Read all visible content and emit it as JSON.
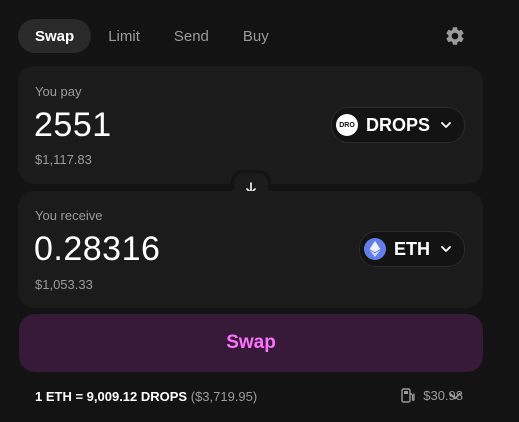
{
  "tabs": [
    {
      "label": "Swap",
      "active": true
    },
    {
      "label": "Limit",
      "active": false
    },
    {
      "label": "Send",
      "active": false
    },
    {
      "label": "Buy",
      "active": false
    }
  ],
  "settings_icon": "gear-icon",
  "pay": {
    "label": "You pay",
    "amount": "2551",
    "usd_value": "$1,117.83",
    "token": {
      "symbol": "DROPS",
      "icon_text": "DRO"
    }
  },
  "switch_icon": "arrow-down-icon",
  "receive": {
    "label": "You receive",
    "amount": "0.28316",
    "usd_value": "$1,053.33",
    "token": {
      "symbol": "ETH",
      "icon": "ethereum-icon"
    }
  },
  "action": {
    "swap_label": "Swap"
  },
  "rate": {
    "text": "1 ETH = 9,009.12 DROPS",
    "fiat": "($3,719.95)"
  },
  "gas": {
    "icon": "gas-pump-icon",
    "value": "$30.98"
  },
  "colors": {
    "background": "#131313",
    "panel": "#1b1b1b",
    "accent": "#fc72ff",
    "accent_bg": "#361a37",
    "muted_text": "#9b9b9b",
    "eth": "#627eea"
  }
}
